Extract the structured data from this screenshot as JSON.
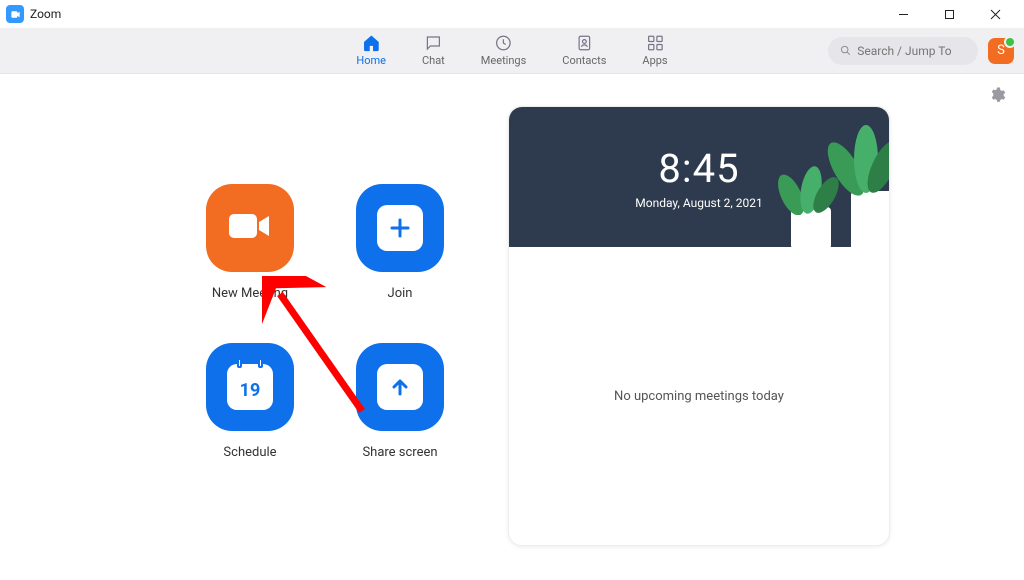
{
  "window": {
    "title": "Zoom"
  },
  "tabs": {
    "home": "Home",
    "chat": "Chat",
    "meetings": "Meetings",
    "contacts": "Contacts",
    "apps": "Apps"
  },
  "search": {
    "placeholder": "Search / Jump To"
  },
  "avatar": {
    "initial": "S"
  },
  "actions": {
    "new_meeting": "New Meeting",
    "join": "Join",
    "schedule": "Schedule",
    "schedule_day": "19",
    "share_screen": "Share screen"
  },
  "clock": {
    "time": "8:45",
    "date": "Monday, August 2, 2021"
  },
  "upcoming": {
    "empty": "No upcoming meetings today"
  }
}
